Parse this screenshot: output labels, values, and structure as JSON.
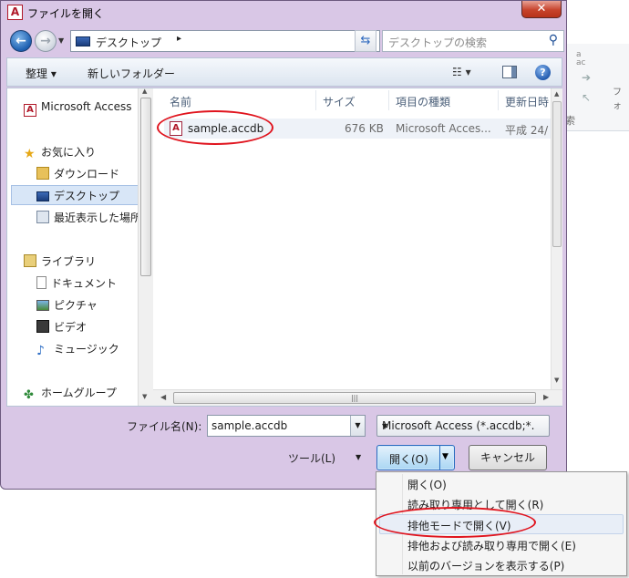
{
  "window": {
    "title": "ファイルを開く",
    "close_label": "✕"
  },
  "navbar": {
    "path": "デスクトップ",
    "search_placeholder": "デスクトップの検索"
  },
  "toolbar": {
    "organize": "整理 ▾",
    "new_folder": "新しいフォルダー"
  },
  "nav_pane": {
    "items": [
      {
        "label": "Microsoft Access",
        "icon": "access-icon"
      },
      {
        "label": "お気に入り",
        "icon": "star-icon"
      },
      {
        "label": "ダウンロード",
        "icon": "download-folder-icon"
      },
      {
        "label": "デスクトップ",
        "icon": "desktop-icon",
        "selected": true
      },
      {
        "label": "最近表示した場所",
        "icon": "recent-places-icon"
      },
      {
        "label": "ライブラリ",
        "icon": "library-icon"
      },
      {
        "label": "ドキュメント",
        "icon": "document-icon"
      },
      {
        "label": "ピクチャ",
        "icon": "picture-icon"
      },
      {
        "label": "ビデオ",
        "icon": "video-icon"
      },
      {
        "label": "ミュージック",
        "icon": "music-icon"
      },
      {
        "label": "ホームグループ",
        "icon": "homegroup-icon"
      }
    ]
  },
  "file_list": {
    "columns": [
      "名前",
      "サイズ",
      "項目の種類",
      "更新日時"
    ],
    "rows": [
      {
        "name": "sample.accdb",
        "size": "676 KB",
        "type": "Microsoft Acces...",
        "modified": "平成 24/"
      }
    ]
  },
  "bottom": {
    "filename_label": "ファイル名(N):",
    "filename_value": "sample.accdb",
    "filetype_value": "Microsoft Access (*.accdb;*.",
    "tools_label": "ツール(L)",
    "open_label": "開く(O)",
    "cancel_label": "キャンセル"
  },
  "open_menu": {
    "items": [
      "開く(O)",
      "読み取り専用として開く(R)",
      "排他モードで開く(V)",
      "排他および読み取り専用で開く(E)",
      "以前のバージョンを表示する(P)"
    ]
  },
  "background_app": {
    "ribbon_text1": "フォ",
    "ribbon_text2": "索"
  },
  "colors": {
    "dialog_frame": "#d9c7e6",
    "highlight_circle": "#e0141e",
    "selection": "#d8e6f7"
  }
}
